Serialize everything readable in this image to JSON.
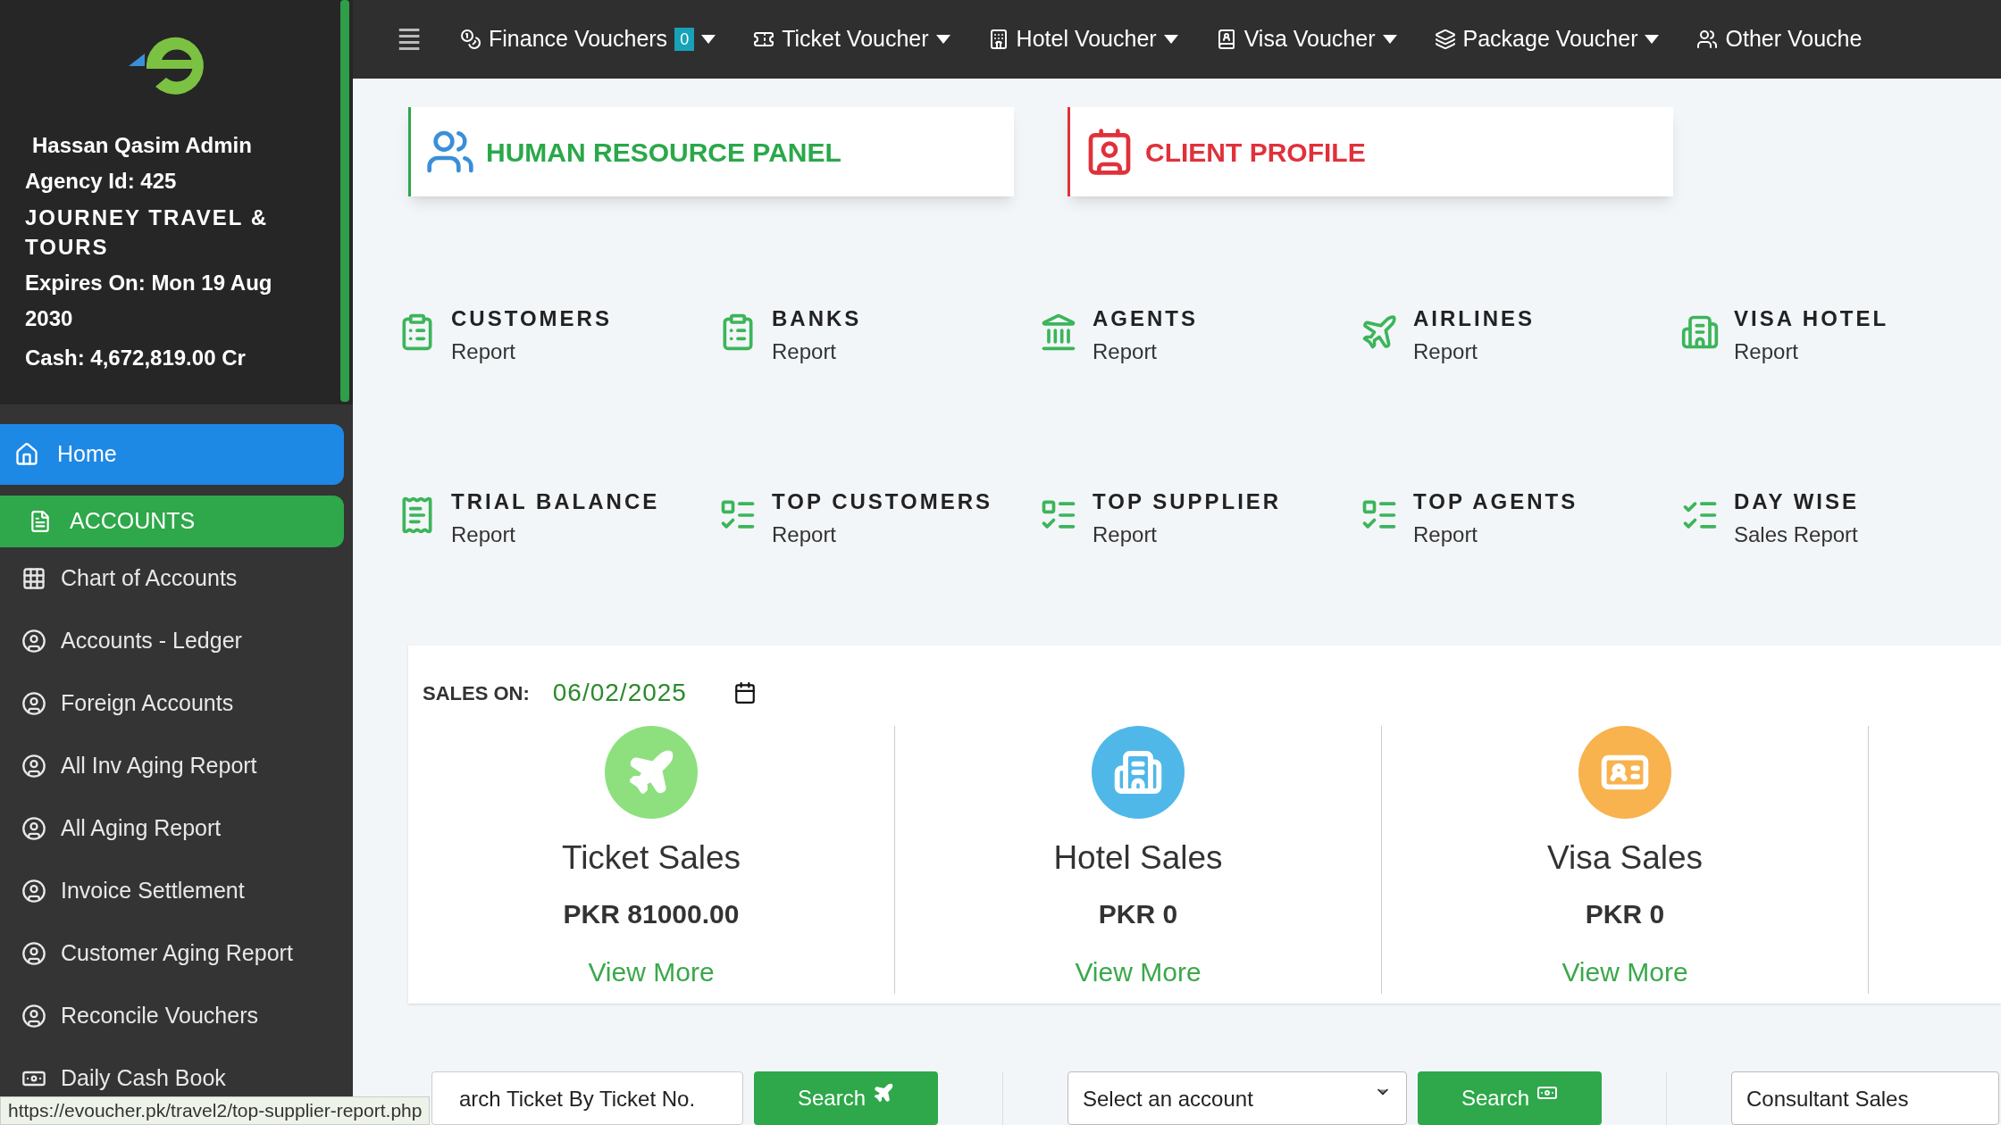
{
  "sidebar": {
    "user_name": "Hassan Qasim Admin",
    "agency_id": "Agency Id: 425",
    "company": "JOURNEY TRAVEL & TOURS",
    "expires": "Expires On: Mon 19 Aug 2030",
    "cash": "Cash: 4,672,819.00 Cr",
    "items": [
      {
        "label": "Home",
        "selected": true
      },
      {
        "label": "ACCOUNTS",
        "selected": false,
        "expanded": true,
        "children": [
          {
            "label": "Chart of Accounts",
            "selected": false
          },
          {
            "label": "Accounts - Ledger",
            "selected": false
          },
          {
            "label": "Foreign Accounts",
            "selected": false
          },
          {
            "label": "All Inv Aging Report",
            "selected": false
          },
          {
            "label": "All Aging Report",
            "selected": false
          },
          {
            "label": "Invoice Settlement",
            "selected": false
          },
          {
            "label": "Customer Aging Report",
            "selected": false
          },
          {
            "label": "Reconcile Vouchers",
            "selected": false
          },
          {
            "label": "Daily Cash Book",
            "selected": false
          }
        ]
      }
    ]
  },
  "top_nav": {
    "menu_icon": "≣",
    "items": [
      {
        "label": "Finance Vouchers",
        "badge": "0"
      },
      {
        "label": "Ticket Voucher"
      },
      {
        "label": "Hotel Voucher"
      },
      {
        "label": "Visa Voucher"
      },
      {
        "label": "Package Voucher"
      },
      {
        "label": "Other Vouche"
      }
    ]
  },
  "panels": [
    {
      "title": "HUMAN RESOURCE PANEL",
      "color": "#2aa84a"
    },
    {
      "title": "CLIENT PROFILE",
      "color": "#e0313b"
    }
  ],
  "reports": [
    {
      "title": "CUSTOMERS",
      "subtitle": "Report"
    },
    {
      "title": "BANKS",
      "subtitle": "Report"
    },
    {
      "title": "AGENTS",
      "subtitle": "Report"
    },
    {
      "title": "AIRLINES",
      "subtitle": "Report"
    },
    {
      "title": "VISA HOTEL",
      "subtitle": "Report"
    },
    {
      "title": "TRIAL BALANCE",
      "subtitle": "Report"
    },
    {
      "title": "TOP CUSTOMERS",
      "subtitle": "Report"
    },
    {
      "title": "TOP SUPPLIER",
      "subtitle": "Report"
    },
    {
      "title": "TOP AGENTS",
      "subtitle": "Report"
    },
    {
      "title": "DAY WISE",
      "subtitle": "Sales Report"
    }
  ],
  "sales": {
    "label": "SALES ON:",
    "date": "06/02/2025",
    "cards": [
      {
        "title": "Ticket Sales",
        "amount": "PKR 81000.00",
        "link": "View More",
        "color": "#8ee07f"
      },
      {
        "title": "Hotel Sales",
        "amount": "PKR 0",
        "link": "View More",
        "color": "#4fb8e8"
      },
      {
        "title": "Visa Sales",
        "amount": "PKR 0",
        "link": "View More",
        "color": "#f8b24e"
      }
    ]
  },
  "bottom": {
    "ticket_search": "arch Ticket By Ticket No.",
    "search_buttons": [
      "Search",
      "Search"
    ],
    "account_select": "Select an account",
    "consultant": "Consultant Sales"
  },
  "status_url": "https://evoucher.pk/travel2/top-supplier-report.php"
}
